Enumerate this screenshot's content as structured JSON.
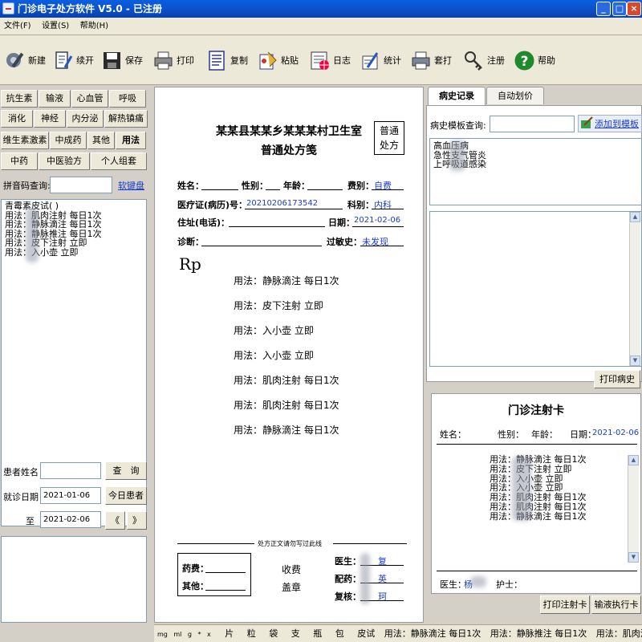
{
  "window": {
    "title": "门诊电子处方软件 V5.0 - 已注册",
    "controls": [
      "_",
      "□",
      "×"
    ]
  },
  "menu": [
    "文件(F)",
    "设置(S)",
    "帮助(H)"
  ],
  "toolbar": [
    {
      "label": "新建",
      "icon": "new-icon"
    },
    {
      "label": "续开",
      "icon": "continue-icon"
    },
    {
      "label": "保存",
      "icon": "save-icon"
    },
    {
      "label": "打印",
      "icon": "print-icon"
    },
    {
      "label": "复制",
      "icon": "copy-icon"
    },
    {
      "label": "粘贴",
      "icon": "paste-icon"
    },
    {
      "label": "日志",
      "icon": "log-icon"
    },
    {
      "label": "统计",
      "icon": "stats-icon"
    },
    {
      "label": "套打",
      "icon": "template-print-icon"
    },
    {
      "label": "注册",
      "icon": "register-icon"
    },
    {
      "label": "帮助",
      "icon": "help-icon"
    }
  ],
  "categories": [
    "抗生素",
    "输液",
    "心血管",
    "呼吸",
    "消化",
    "神经",
    "内分泌",
    "解热镇痛",
    "维生素激素",
    "中成药",
    "其他",
    "用法",
    "中药",
    "中医验方",
    "个人组套"
  ],
  "pinyin": {
    "label": "拼音码查询:",
    "value": "",
    "keyboard": "软键盘"
  },
  "usage_list": [
    "青霉素皮试( )",
    "用法：肌肉注射 每日1次",
    "用法：静脉滴注 每日1次",
    "用法：静脉推注 每日1次",
    "用法：皮下注射 立即",
    "用法：入小壶 立即"
  ],
  "patient_search": {
    "name_label": "患者姓名",
    "name_value": "",
    "query_btn": "查　询",
    "date_label": "就诊日期",
    "date_from": "2021-01-06",
    "today_btn": "今日患者",
    "to_label": "至",
    "date_to": "2021-02-06",
    "prev": "《",
    "next": "》"
  },
  "prescription": {
    "title": "某某县某某乡某某某村卫生室",
    "subtitle": "普通处方笺",
    "type_box": [
      "普通",
      "处方"
    ],
    "name_label": "姓名：",
    "gender_label": "性别：",
    "age_label": "年龄：",
    "fee_label": "费别：",
    "fee_value": "自费",
    "card_label": "医疗证(病历)号：",
    "card_value": "20210206173542",
    "dept_label": "科别：",
    "dept_value": "内科",
    "addr_label": "住址(电话)：",
    "date_label": "日期：",
    "date_value": "2021-02-06",
    "diag_label": "诊断：",
    "allergy_label": "过敏史：",
    "allergy_value": "未发现",
    "rp": "Rp",
    "lines": [
      "用法：静脉滴注 每日1次",
      "用法：皮下注射 立即",
      "用法：入小壶 立即",
      "用法：入小壶 立即",
      "用法：肌肉注射 每日1次",
      "用法：肌肉注射 每日1次",
      "用法：静脉滴注 每日1次"
    ],
    "footer_note": "处方正文请勿写过此线",
    "drug_fee_label": "药费：",
    "other_label": "其他：",
    "charge_label": "收费",
    "stamp_label": "盖章",
    "doctor_label": "医生：",
    "doctor_value": "复",
    "dispense_label": "配药：",
    "dispense_value": "英",
    "review_label": "复核：",
    "review_value": "珂"
  },
  "right": {
    "tabs": [
      "病史记录",
      "自动划价"
    ],
    "history_query_label": "病史模板查询:",
    "history_query_value": "",
    "add_template": "添加到模板",
    "history_list": [
      "高血压病",
      "急性支气管炎",
      "上呼吸道感染"
    ],
    "print_history": "打印病史",
    "card_title": "门诊注射卡",
    "card_name_label": "姓名：",
    "card_gender_label": "性别：",
    "card_age_label": "年龄：",
    "card_date_label": "日期：",
    "card_date_value": "2021-02-06",
    "card_lines": [
      "用法：静脉滴注 每日1次",
      "用法：皮下注射 立即",
      "用法：入小壶 立即",
      "用法：入小壶 立即",
      "用法：肌肉注射 每日1次",
      "用法：肌肉注射 每日1次",
      "用法：静脉滴注 每日1次"
    ],
    "card_doctor_label": "医生：",
    "card_doctor_value": "杨",
    "card_nurse_label": "护士：",
    "print_card": "打印注射卡",
    "infusion_card": "输液执行卡"
  },
  "status_items": [
    "mg",
    "ml",
    "g",
    "*",
    "x",
    "片",
    "粒",
    "袋",
    "支",
    "瓶",
    "包",
    "皮试",
    "用法：静脉滴注 每日1次",
    "用法：静脉推注 每日1次",
    "用法：肌肉注射 每日1"
  ]
}
